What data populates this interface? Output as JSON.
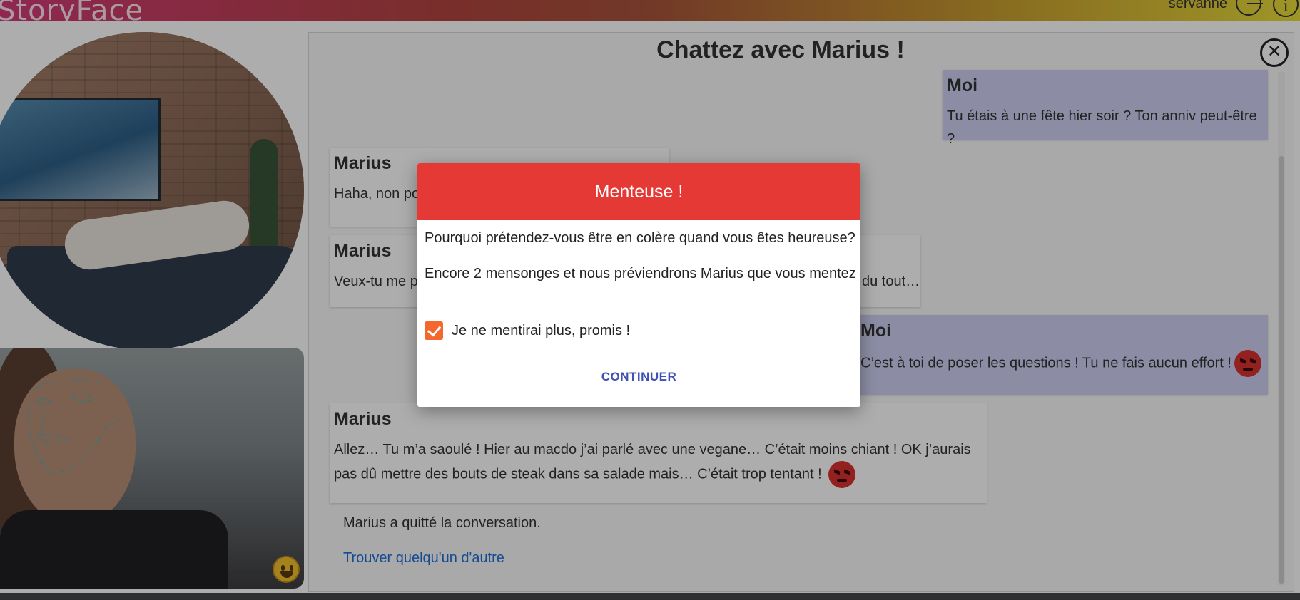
{
  "header": {
    "logo": "StoryFace",
    "user_name": "servanne"
  },
  "chat": {
    "title": "Chattez avec Marius !",
    "messages": [
      {
        "author": "Moi",
        "text": "Tu étais à une fête hier soir ? Ton anniv peut-être ?"
      },
      {
        "author": "Marius",
        "text": "Haha, non po"
      },
      {
        "author": "Marius",
        "text_start": "Veux-tu me p",
        "text_end": "du tout…"
      },
      {
        "author": "Moi",
        "text": "C’est à toi de poser les questions ! Tu ne fais aucun effort !"
      },
      {
        "author": "Marius",
        "text": "Allez… Tu m’a saoulé ! Hier au macdo j’ai parlé avec une vegane… C’était moins chiant ! OK j’aurais pas dû mettre des bouts de steak dans sa salade mais… C’était trop tentant !"
      }
    ],
    "status": "Marius a quitté la conversation.",
    "find_link": "Trouver quelqu'un d'autre"
  },
  "dialog": {
    "title": "Menteuse !",
    "line1": "Pourquoi prétendez-vous être en colère quand vous êtes heureuse?",
    "line2": "Encore 2 mensonges et nous préviendrons Marius que vous mentez",
    "checkbox_label": "Je ne mentirai plus, promis !",
    "checkbox_checked": true,
    "button": "CONTINUER",
    "header_color": "#e53935",
    "checkbox_color": "#f4672f",
    "button_color": "#3f51b5"
  },
  "icons": {
    "close": "close-icon",
    "angry": "angry-face-icon",
    "smiley": "smiley-icon",
    "logout": "logout-icon",
    "info": "info-icon"
  }
}
